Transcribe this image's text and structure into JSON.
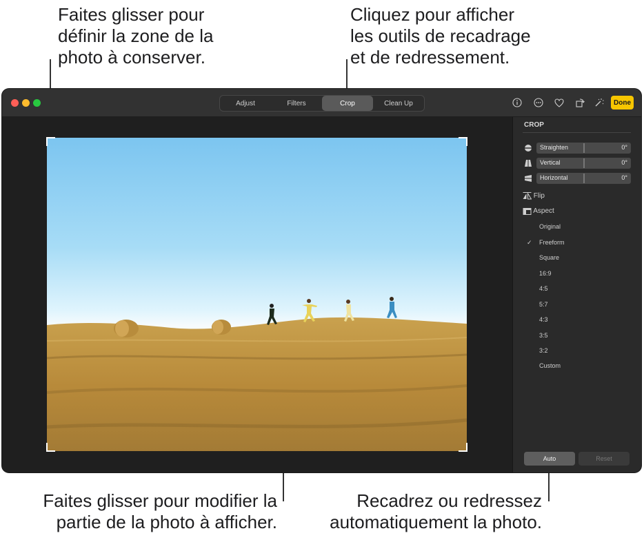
{
  "callouts": {
    "top_left": [
      "Faites glisser pour",
      "définir la zone de la",
      "photo à conserver."
    ],
    "top_right": [
      "Cliquez pour afficher",
      "les outils de recadrage",
      "et de redressement."
    ],
    "bottom_left": [
      "Faites glisser pour modifier la",
      "partie de la photo à afficher."
    ],
    "bottom_right": [
      "Recadrez ou redressez",
      "automatiquement la photo."
    ]
  },
  "toolbar": {
    "tabs": [
      {
        "label": "Adjust"
      },
      {
        "label": "Filters"
      },
      {
        "label": "Crop",
        "active": true
      },
      {
        "label": "Clean Up"
      }
    ],
    "done_label": "Done",
    "icons": [
      "info-icon",
      "more-icon",
      "heart-icon",
      "rotate-icon",
      "magic-wand-icon"
    ]
  },
  "sidebar": {
    "title": "CROP",
    "sliders": [
      {
        "label": "Straighten",
        "value": "0°"
      },
      {
        "label": "Vertical",
        "value": "0°"
      },
      {
        "label": "Horizontal",
        "value": "0°"
      }
    ],
    "flip_label": "Flip",
    "aspect_label": "Aspect",
    "aspect_options": [
      "Original",
      "Freeform",
      "Square",
      "16:9",
      "4:5",
      "5:7",
      "4:3",
      "3:5",
      "3:2",
      "Custom"
    ],
    "aspect_selected": "Freeform",
    "check_mark": "✓",
    "auto_label": "Auto",
    "reset_label": "Reset"
  },
  "colors": {
    "done_button": "#f7c600",
    "close": "#fe5f57",
    "minimize": "#febc2e",
    "zoom": "#28c840"
  }
}
